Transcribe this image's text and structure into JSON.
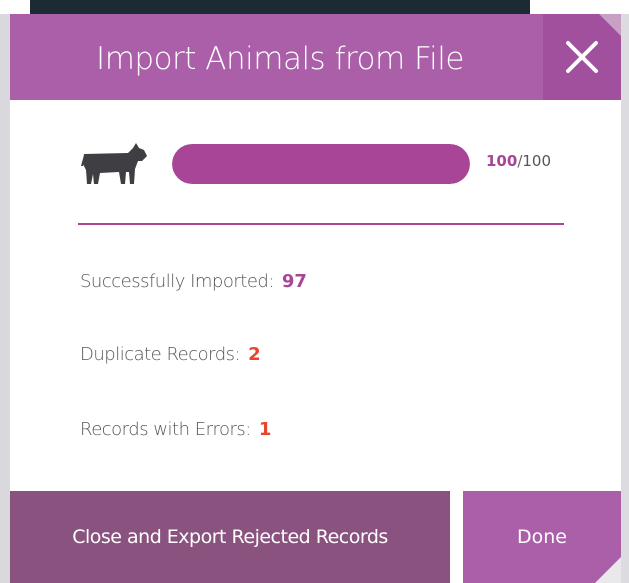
{
  "modal": {
    "title": "Import Animals from File",
    "close_icon": "close-icon",
    "animal_icon": "cow-icon"
  },
  "progress": {
    "done": "100",
    "separator": "/",
    "total": "100",
    "fraction": 1.0
  },
  "stats": {
    "success_label": "Successfully Imported:",
    "success_value": "97",
    "duplicate_label": "Duplicate Records:",
    "duplicate_value": "2",
    "errors_label": "Records with Errors:",
    "errors_value": "1"
  },
  "footer": {
    "export_label": "Close and Export Rejected Records",
    "done_label": "Done"
  },
  "colors": {
    "header": "#ac5fa9",
    "accent": "#a84597",
    "export_button": "#8a527e",
    "error": "#e8452c"
  }
}
